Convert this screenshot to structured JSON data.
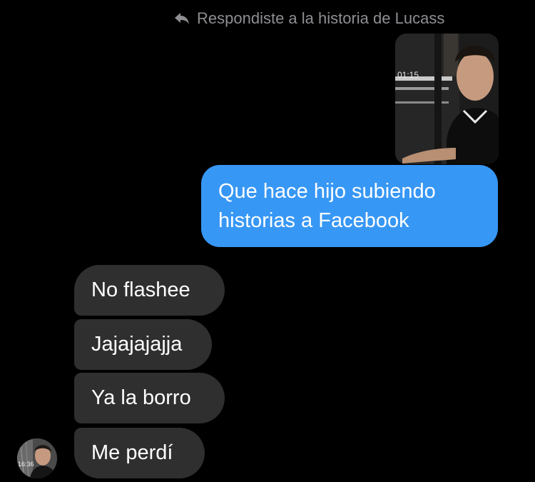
{
  "reply_header": {
    "text": "Respondiste a la historia de Lucass",
    "icon": "reply-arrow-icon"
  },
  "story": {
    "timestamp": "01:15"
  },
  "messages_sent": [
    {
      "text": "Que hace hijo subiendo historias a Facebook"
    }
  ],
  "messages_received": [
    {
      "text": "No flashee"
    },
    {
      "text": "Jajajajajja"
    },
    {
      "text": "Ya la borro"
    },
    {
      "text": "Me perdí"
    }
  ],
  "avatar": {
    "timestamp": "16:36"
  },
  "colors": {
    "background": "#000000",
    "sent_bubble": "#3797f5",
    "received_bubble": "#2f2f30",
    "header_text": "#8e8e93"
  }
}
